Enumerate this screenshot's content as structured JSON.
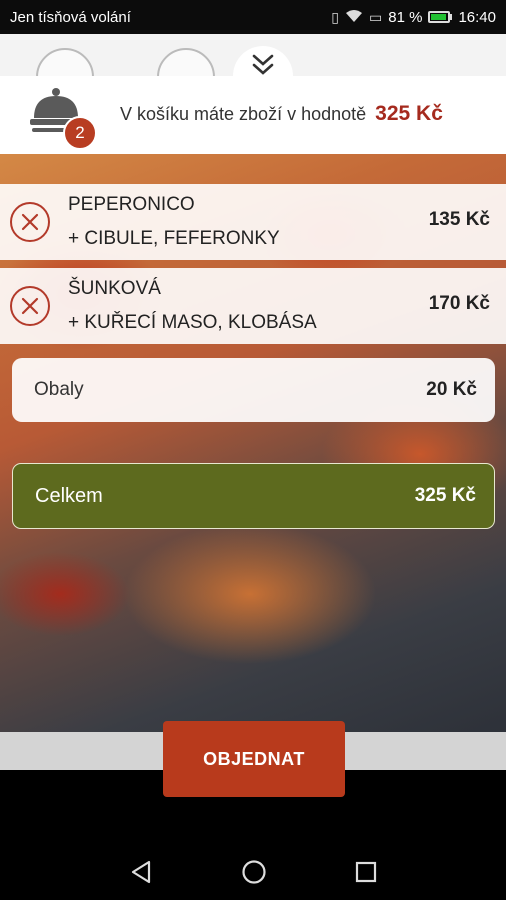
{
  "status_bar": {
    "carrier": "Jen tísňová volání",
    "battery_percent": "81 %",
    "battery_level": 0.81,
    "time": "16:40"
  },
  "cart": {
    "summary_text": "V košíku máte zboží v hodnotě",
    "summary_total": "325 Kč",
    "item_count": "2",
    "items": [
      {
        "name": "PEPERONICO",
        "extras": "+ CIBULE, FEFERONKY",
        "price": "135 Kč"
      },
      {
        "name": "ŠUNKOVÁ",
        "extras": "+ KUŘECÍ MASO, KLOBÁSA",
        "price": "170 Kč"
      }
    ],
    "packaging": {
      "label": "Obaly",
      "price": "20 Kč"
    },
    "total": {
      "label": "Celkem",
      "price": "325 Kč"
    }
  },
  "actions": {
    "order_label": "OBJEDNAT"
  },
  "icons": {
    "collapse": "double-chevron-down-icon",
    "cloche": "cloche-icon",
    "remove": "remove-circle-x-icon",
    "back": "back-triangle-icon",
    "home": "home-circle-icon",
    "recents": "recents-square-icon"
  },
  "colors": {
    "accent_red": "#b83a1c",
    "total_green": "#5d6a1e",
    "price_red": "#a52a1e"
  }
}
